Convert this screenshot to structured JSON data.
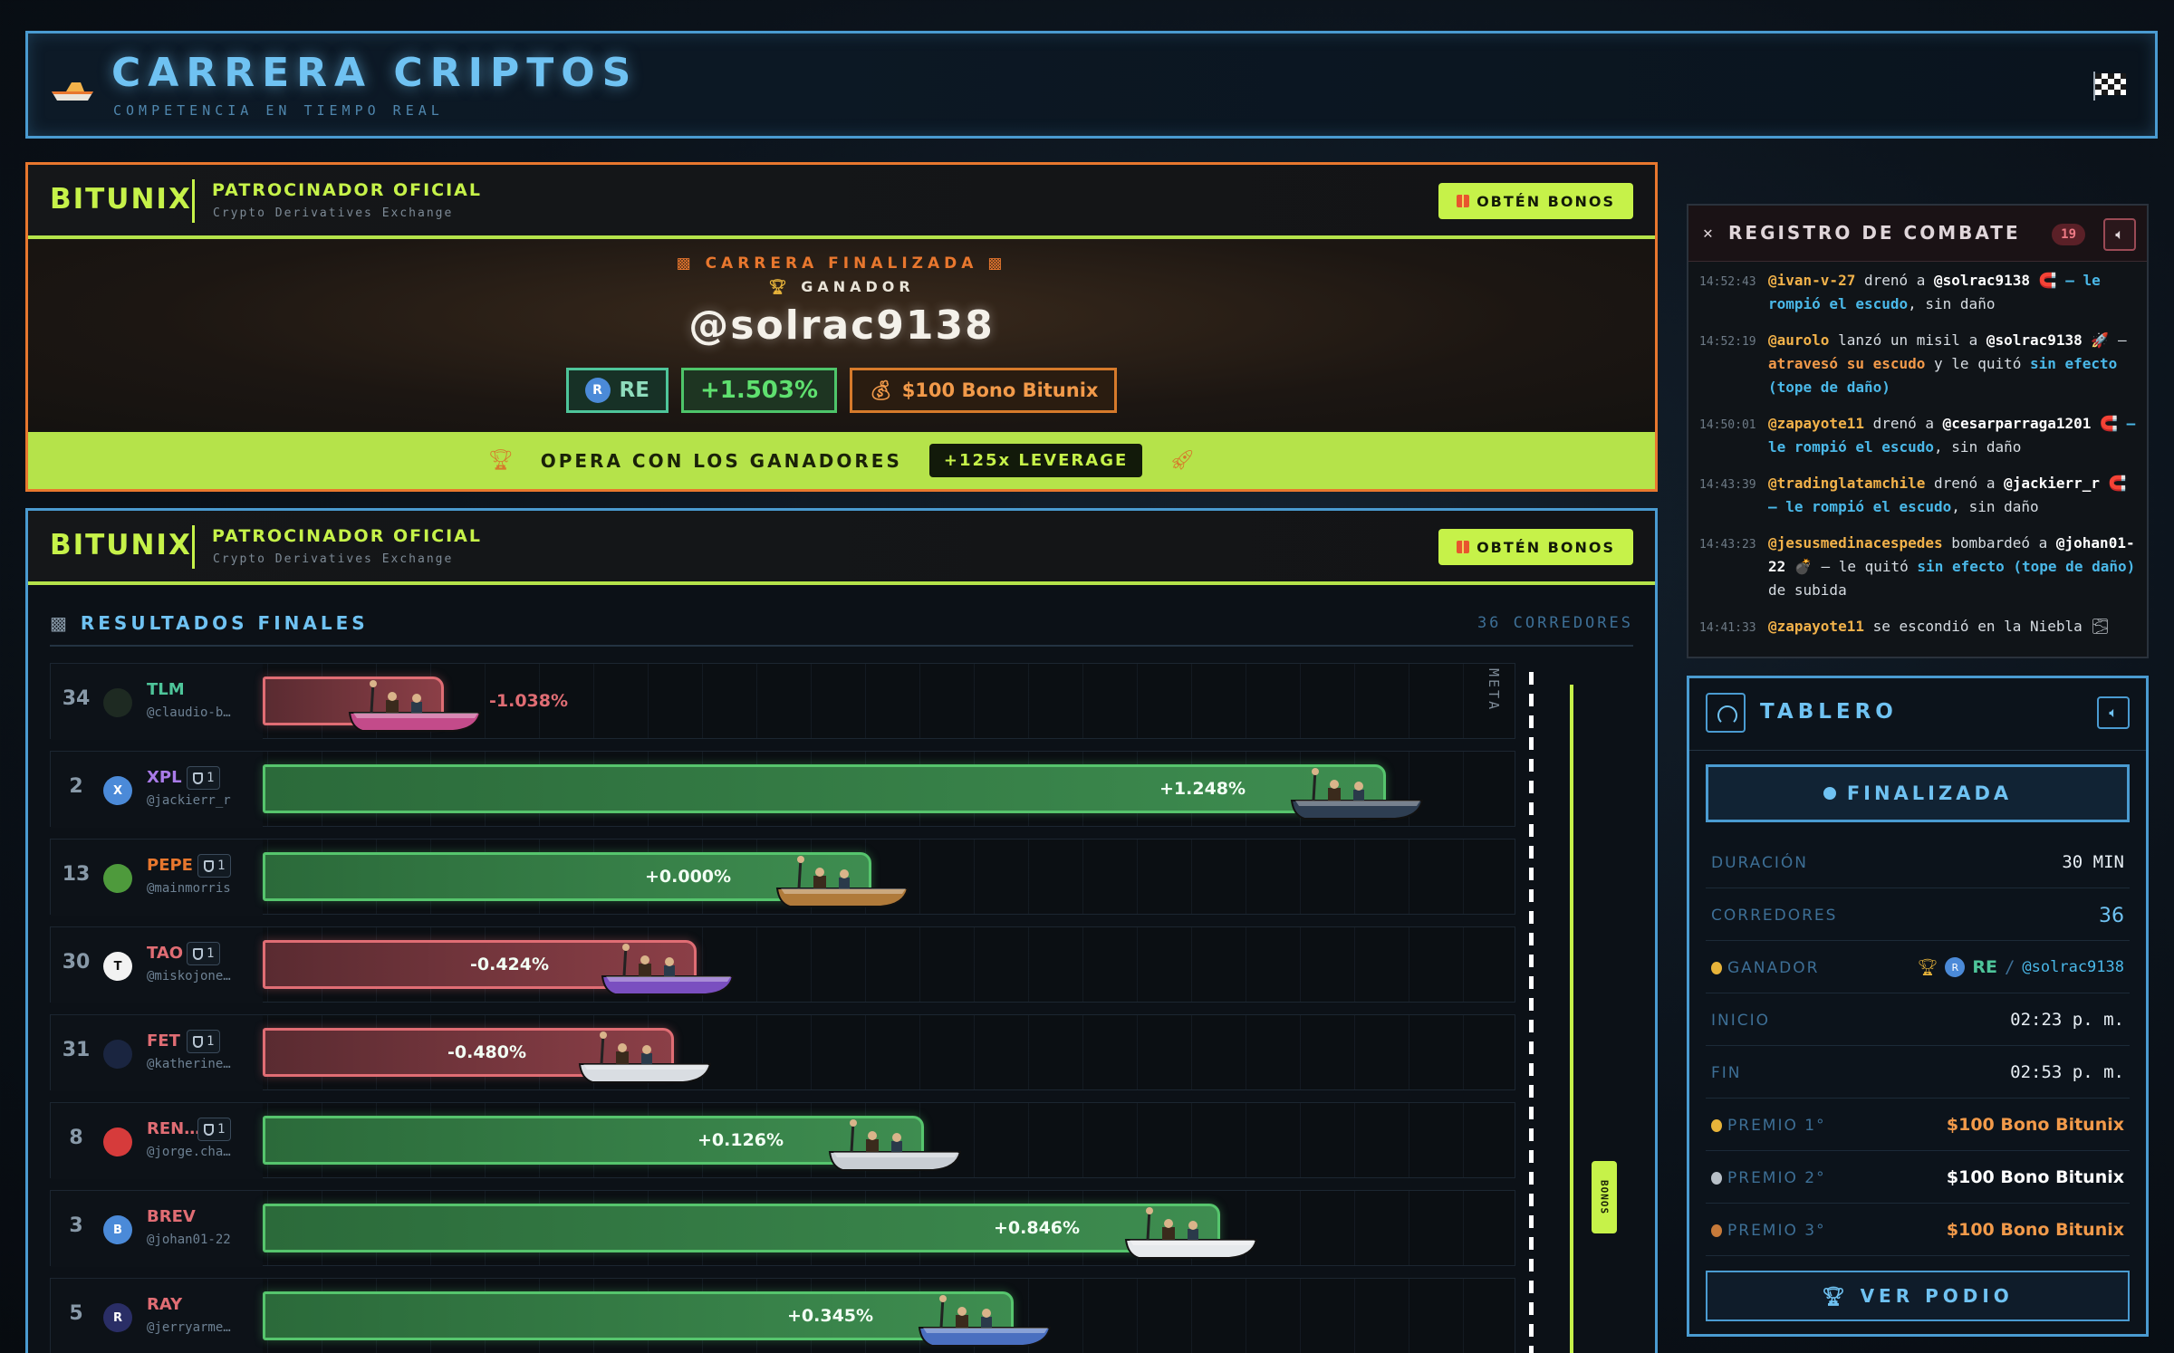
{
  "header": {
    "title": "CARRERA CRIPTOS",
    "subtitle": "COMPETENCIA EN TIEMPO REAL",
    "boat_icon": "speedboat-icon",
    "flag_icon": "checkered-flag-icon"
  },
  "sponsor": {
    "logo": "BITUNIX",
    "title": "PATROCINADOR OFICIAL",
    "subtitle": "Crypto Derivatives Exchange",
    "bonus_button": "OBTÉN BONOS"
  },
  "winner": {
    "status": "CARRERA FINALIZADA",
    "label": "GANADOR",
    "name": "@solrac9138",
    "coin_letter": "R",
    "coin": "RE",
    "pct": "+1.503%",
    "prize": "$100 Bono Bitunix"
  },
  "trade_strip": {
    "text": "OPERA CON LOS GANADORES",
    "leverage": "+125x LEVERAGE"
  },
  "results": {
    "title": "RESULTADOS FINALES",
    "count": "36 CORREDORES",
    "meta_label": "META",
    "bonus_tag": "BONOS",
    "lanes": [
      {
        "rank": "34",
        "symbol": "TLM",
        "user": "@claudio-b…",
        "shields": "",
        "pct": "-1.038%",
        "value": -1.038,
        "avatar": "",
        "avatar_color": "#1e2a22",
        "symbol_color": "#4ec59a"
      },
      {
        "rank": "2",
        "symbol": "XPL",
        "user": "@jackierr_r",
        "shields": "1",
        "pct": "+1.248%",
        "value": 1.248,
        "avatar": "X",
        "avatar_color": "#4b8ad8",
        "symbol_color": "#a97be8"
      },
      {
        "rank": "13",
        "symbol": "PEPE",
        "user": "@mainmorris",
        "shields": "1",
        "pct": "+0.000%",
        "value": 0.0,
        "avatar": "",
        "avatar_color": "#4e9a3c",
        "symbol_color": "#e8772e"
      },
      {
        "rank": "30",
        "symbol": "TAO",
        "user": "@miskojone…",
        "shields": "1",
        "pct": "-0.424%",
        "value": -0.424,
        "avatar": "T",
        "avatar_color": "#f2f2f2",
        "symbol_color": "#e06d74"
      },
      {
        "rank": "31",
        "symbol": "FET",
        "user": "@katherine…",
        "shields": "1",
        "pct": "-0.480%",
        "value": -0.48,
        "avatar": "",
        "avatar_color": "#1a2540",
        "symbol_color": "#e06d74"
      },
      {
        "rank": "8",
        "symbol": "REN…",
        "user": "@jorge.cha…",
        "shields": "1",
        "pct": "+0.126%",
        "value": 0.126,
        "avatar": "",
        "avatar_color": "#d63b3b",
        "symbol_color": "#e06d74"
      },
      {
        "rank": "3",
        "symbol": "BREV",
        "user": "@johan01-22",
        "shields": "",
        "pct": "+0.846%",
        "value": 0.846,
        "avatar": "B",
        "avatar_color": "#4b8ad8",
        "symbol_color": "#e06d74"
      },
      {
        "rank": "5",
        "symbol": "RAY",
        "user": "@jerryarme…",
        "shields": "",
        "pct": "+0.345%",
        "value": 0.345,
        "avatar": "R",
        "avatar_color": "#2a2e66",
        "symbol_color": "#e06d74"
      }
    ]
  },
  "combat": {
    "title": "REGISTRO DE COMBATE",
    "count": "19",
    "entries": [
      {
        "time": "14:52:43",
        "parts": [
          [
            "u",
            "@ivan-v-27"
          ],
          [
            "t",
            " drenó a "
          ],
          [
            "v",
            "@solrac9138"
          ],
          [
            "t",
            " 🧲 "
          ],
          [
            "e",
            "– le rompió el escudo"
          ],
          [
            "t",
            ", sin daño"
          ]
        ]
      },
      {
        "time": "14:52:19",
        "parts": [
          [
            "u",
            "@aurolo"
          ],
          [
            "t",
            " lanzó un misil a "
          ],
          [
            "v",
            "@solrac9138"
          ],
          [
            "t",
            " 🚀 – "
          ],
          [
            "o",
            "atravesó su escudo"
          ],
          [
            "t",
            " y le quitó "
          ],
          [
            "e",
            "sin efecto (tope de daño)"
          ]
        ]
      },
      {
        "time": "14:50:01",
        "parts": [
          [
            "u",
            "@zapayote11"
          ],
          [
            "t",
            " drenó a "
          ],
          [
            "v",
            "@cesarparraga1201"
          ],
          [
            "t",
            " 🧲 "
          ],
          [
            "e",
            "– le rompió el escudo"
          ],
          [
            "t",
            ", sin daño"
          ]
        ]
      },
      {
        "time": "14:43:39",
        "parts": [
          [
            "u",
            "@tradinglatamchile"
          ],
          [
            "t",
            " drenó a "
          ],
          [
            "v",
            "@jackierr_r"
          ],
          [
            "t",
            " 🧲 "
          ],
          [
            "e",
            "– le rompió el escudo"
          ],
          [
            "t",
            ", sin daño"
          ]
        ]
      },
      {
        "time": "14:43:23",
        "parts": [
          [
            "u",
            "@jesusmedinacespedes"
          ],
          [
            "t",
            " bombardeó a "
          ],
          [
            "v",
            "@johan01-22"
          ],
          [
            "t",
            " 💣 – le quitó "
          ],
          [
            "e",
            "sin efecto (tope de daño)"
          ],
          [
            "t",
            " de subida"
          ]
        ]
      },
      {
        "time": "14:41:33",
        "parts": [
          [
            "u",
            "@zapayote11"
          ],
          [
            "t",
            " se escondió en la Niebla 🌫"
          ]
        ]
      }
    ]
  },
  "dashboard": {
    "title": "TABLERO",
    "status": "FINALIZADA",
    "rows": {
      "duration_k": "DURACIÓN",
      "duration_v": "30 MIN",
      "racers_k": "CORREDORES",
      "racers_v": "36",
      "winner_k": "GANADOR",
      "winner_coin_letter": "R",
      "winner_coin": "RE",
      "winner_sep": "/",
      "winner_user": "@solrac9138",
      "start_k": "INICIO",
      "start_v": "02:23 p. m.",
      "end_k": "FIN",
      "end_v": "02:53 p. m.",
      "prize1_k": "PREMIO 1°",
      "prize1_v": "$100 Bono Bitunix",
      "prize2_k": "PREMIO 2°",
      "prize2_v": "$100 Bono Bitunix",
      "prize3_k": "PREMIO 3°",
      "prize3_v": "$100 Bono Bitunix"
    },
    "podium_button": "VER PODIO"
  },
  "colors": {
    "accent_blue": "#6fc2f2",
    "sponsor_green": "#c6f249",
    "orange": "#e8772e",
    "positive": "#56c56d",
    "negative": "#e06d74"
  }
}
